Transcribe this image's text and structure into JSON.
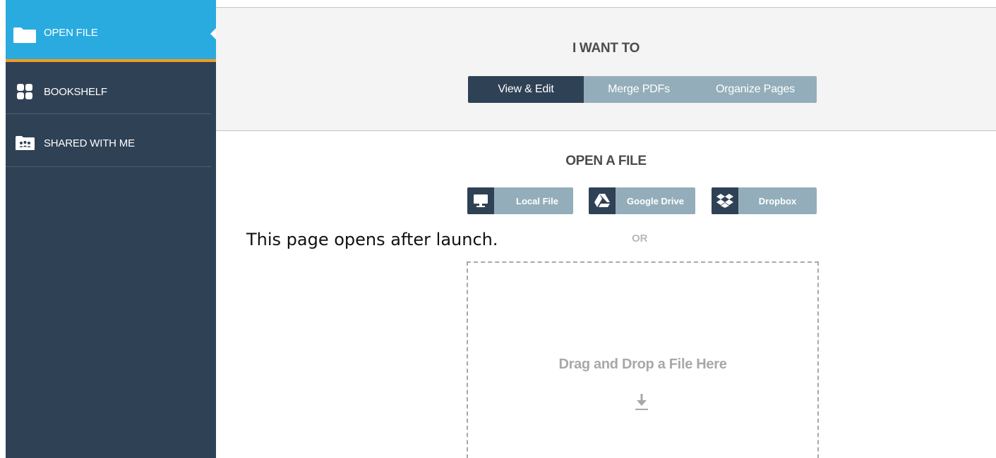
{
  "sidebar": {
    "items": [
      {
        "label": "OPEN FILE",
        "icon": "folder-icon",
        "active": true
      },
      {
        "label": "BOOKSHELF",
        "icon": "grid-icon",
        "active": false
      },
      {
        "label": "SHARED WITH ME",
        "icon": "shared-folder-icon",
        "active": false
      }
    ]
  },
  "main": {
    "want_title": "I WANT TO",
    "modes": [
      {
        "label": "View & Edit",
        "selected": true
      },
      {
        "label": "Merge PDFs",
        "selected": false
      },
      {
        "label": "Organize Pages",
        "selected": false
      }
    ],
    "open_title": "OPEN A FILE",
    "sources": [
      {
        "label": "Local File",
        "icon": "monitor-icon"
      },
      {
        "label": "Google Drive",
        "icon": "google-drive-icon"
      },
      {
        "label": "Dropbox",
        "icon": "dropbox-icon"
      }
    ],
    "or_label": "OR",
    "dropzone_text": "Drag and Drop a File Here",
    "dropzone_icon": "download-icon"
  },
  "caption": "This page opens after launch.",
  "colors": {
    "sidebar_bg": "#2f4155",
    "active_bg": "#29abe0",
    "active_underline": "#f49b1f",
    "button_light": "#93aeba",
    "button_dark": "#2f4155",
    "panel_bg": "#f4f4f5"
  }
}
